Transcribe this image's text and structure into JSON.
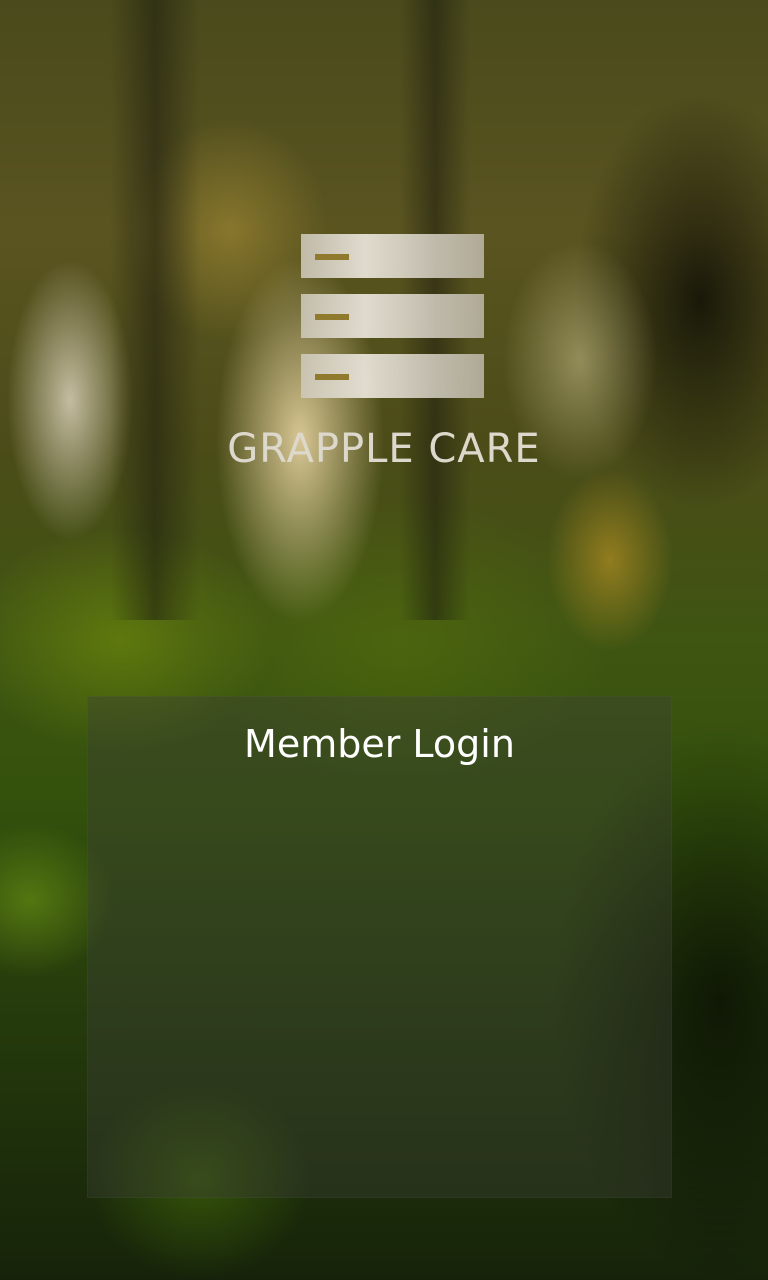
{
  "app": {
    "brand_name": "GRAPPLE CARE",
    "logo_icon": "stacked-server-icon"
  },
  "login_panel": {
    "title": "Member Login"
  },
  "colors": {
    "brand_text": "#ddd8cc",
    "title_text": "#ffffff",
    "logo_dash": "#8f7a2e"
  }
}
